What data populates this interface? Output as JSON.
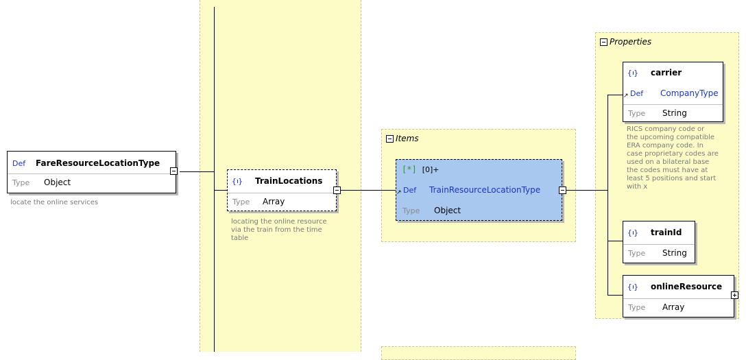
{
  "root": {
    "def_label": "Def",
    "name": "FareResourceLocationType",
    "type_label": "Type",
    "type_value": "Object",
    "description": "locate the online services"
  },
  "train_locations": {
    "name": "TrainLocations",
    "type_label": "Type",
    "type_value": "Array",
    "description": [
      "locating the online resource",
      "via the train from the time",
      "table"
    ]
  },
  "items": {
    "header": "Items",
    "index_label": "[0]+",
    "def_label": "Def",
    "def_value": "TrainResourceLocationType",
    "type_label": "Type",
    "type_value": "Object"
  },
  "properties": {
    "header": "Properties",
    "carrier": {
      "name": "carrier",
      "def_label": "Def",
      "def_value": "CompanyType",
      "type_label": "Type",
      "type_value": "String",
      "description": [
        "RICS company code or",
        "the upcoming compatible",
        "ERA company code. In",
        "case proprietary codes are",
        "used on a bilateral base",
        "the codes must have at",
        "least 5 positions and start",
        "with x"
      ]
    },
    "train_id": {
      "name": "trainId",
      "type_label": "Type",
      "type_value": "String"
    },
    "online_resource": {
      "name": "onlineResource",
      "type_label": "Type",
      "type_value": "Array"
    }
  }
}
